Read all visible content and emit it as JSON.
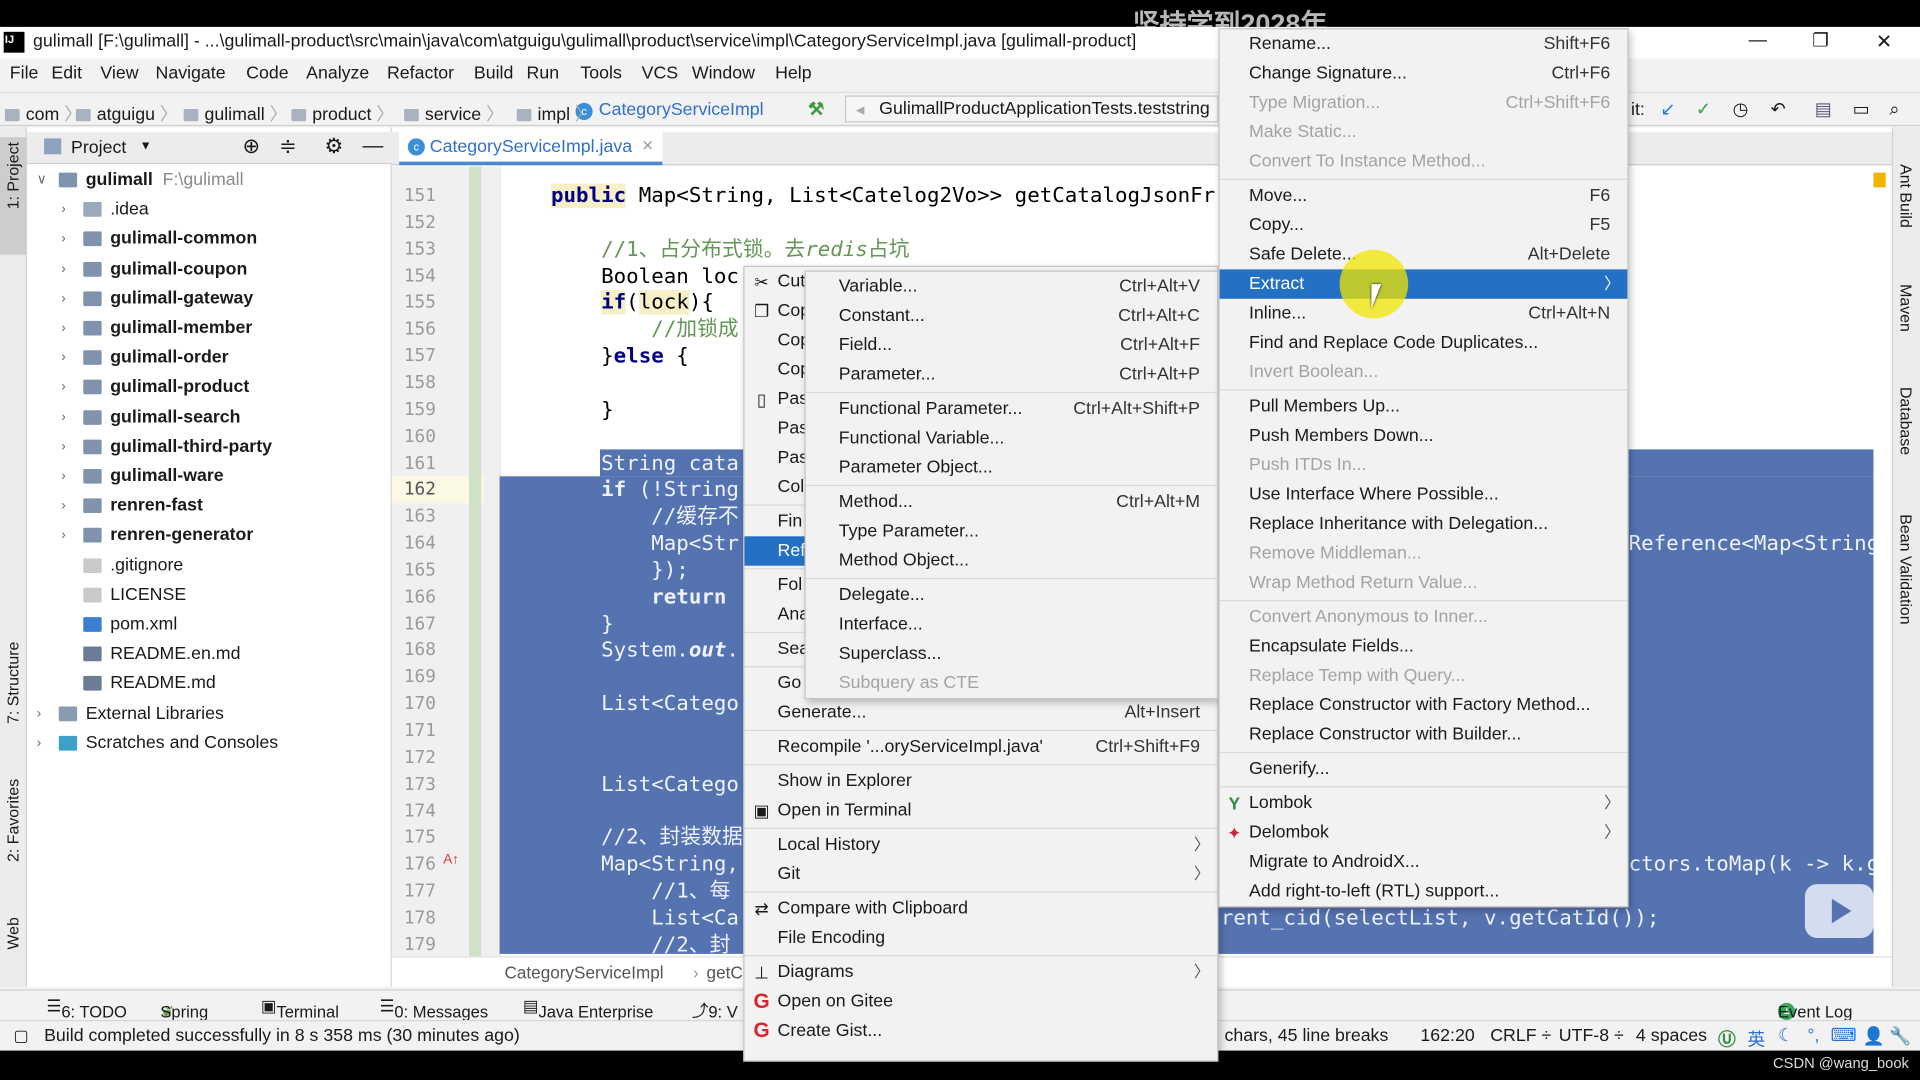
{
  "overlay": {
    "watermark": "坚持学到2028年",
    "credit": "CSDN @wang_book"
  },
  "titlebar": {
    "title": "gulimall [F:\\gulimall] - ...\\gulimall-product\\src\\main\\java\\com\\atguigu\\gulimall\\product\\service\\impl\\CategoryServiceImpl.java [gulimall-product]",
    "minimize": "—",
    "restore": "❐",
    "close": "✕"
  },
  "menubar": [
    "File",
    "Edit",
    "View",
    "Navigate",
    "Code",
    "Analyze",
    "Refactor",
    "Build",
    "Run",
    "Tools",
    "VCS",
    "Window",
    "Help"
  ],
  "navbar": {
    "crumbs": [
      "com",
      "atguigu",
      "gulimall",
      "product",
      "service",
      "impl"
    ],
    "current_class": "CategoryServiceImpl",
    "run_config": "GulimallProductApplicationTests.teststring",
    "git_label": "it:"
  },
  "left_strip": {
    "project": "1: Project",
    "structure": "7: Structure",
    "favorites": "2: Favorites",
    "web": "Web"
  },
  "right_strip": {
    "ant": "Ant Build",
    "maven": "Maven",
    "database": "Database",
    "bean": "Bean Validation"
  },
  "project": {
    "header": "Project",
    "tree": [
      {
        "label": "gulimall",
        "hint": "F:\\gulimall",
        "bold": true,
        "indent": 0,
        "arrow": "∨",
        "icon": "module-folder-icon"
      },
      {
        "label": ".idea",
        "bold": false,
        "indent": 1,
        "arrow": "›",
        "icon": "folder-icon"
      },
      {
        "label": "gulimall-common",
        "bold": true,
        "indent": 1,
        "arrow": "›",
        "icon": "module-folder-icon"
      },
      {
        "label": "gulimall-coupon",
        "bold": true,
        "indent": 1,
        "arrow": "›",
        "icon": "module-folder-icon"
      },
      {
        "label": "gulimall-gateway",
        "bold": true,
        "indent": 1,
        "arrow": "›",
        "icon": "module-folder-icon"
      },
      {
        "label": "gulimall-member",
        "bold": true,
        "indent": 1,
        "arrow": "›",
        "icon": "module-folder-icon"
      },
      {
        "label": "gulimall-order",
        "bold": true,
        "indent": 1,
        "arrow": "›",
        "icon": "module-folder-icon"
      },
      {
        "label": "gulimall-product",
        "bold": true,
        "indent": 1,
        "arrow": "›",
        "icon": "module-folder-icon"
      },
      {
        "label": "gulimall-search",
        "bold": true,
        "indent": 1,
        "arrow": "›",
        "icon": "module-folder-icon"
      },
      {
        "label": "gulimall-third-party",
        "bold": true,
        "indent": 1,
        "arrow": "›",
        "icon": "module-folder-icon"
      },
      {
        "label": "gulimall-ware",
        "bold": true,
        "indent": 1,
        "arrow": "›",
        "icon": "module-folder-icon"
      },
      {
        "label": "renren-fast",
        "bold": true,
        "indent": 1,
        "arrow": "›",
        "icon": "module-folder-icon"
      },
      {
        "label": "renren-generator",
        "bold": true,
        "indent": 1,
        "arrow": "›",
        "icon": "module-folder-icon"
      },
      {
        "label": ".gitignore",
        "bold": false,
        "indent": 1,
        "arrow": "",
        "icon": "file-icon"
      },
      {
        "label": "LICENSE",
        "bold": false,
        "indent": 1,
        "arrow": "",
        "icon": "file-icon"
      },
      {
        "label": "pom.xml",
        "bold": false,
        "indent": 1,
        "arrow": "",
        "icon": "maven-icon"
      },
      {
        "label": "README.en.md",
        "bold": false,
        "indent": 1,
        "arrow": "",
        "icon": "markdown-icon"
      },
      {
        "label": "README.md",
        "bold": false,
        "indent": 1,
        "arrow": "",
        "icon": "markdown-icon"
      },
      {
        "label": "External Libraries",
        "bold": false,
        "indent": 0,
        "arrow": "›",
        "icon": "library-icon"
      },
      {
        "label": "Scratches and Consoles",
        "bold": false,
        "indent": 0,
        "arrow": "›",
        "icon": "scratches-icon"
      }
    ]
  },
  "editor": {
    "tab": "CategoryServiceImpl.java",
    "current_line": 162,
    "lines": [
      {
        "num": "151",
        "seg": [
          [
            "    ",
            ""
          ],
          [
            "public",
            "kw kwbg"
          ],
          [
            " Map<String, List<Catelog2Vo>> getCatalogJsonFr",
            ""
          ]
        ]
      },
      {
        "num": "152",
        "seg": []
      },
      {
        "num": "153",
        "seg": [
          [
            "        //1、占分布式锁。去",
            "cm"
          ],
          [
            "redis",
            "cm it"
          ],
          [
            "占坑",
            "cm"
          ]
        ]
      },
      {
        "num": "154",
        "seg": [
          [
            "        Boolean loc",
            ""
          ]
        ]
      },
      {
        "num": "155",
        "seg": [
          [
            "        ",
            ""
          ],
          [
            "if",
            "kw kwbg"
          ],
          [
            "(",
            ""
          ],
          [
            "lock",
            "hl"
          ],
          [
            "){",
            ""
          ]
        ]
      },
      {
        "num": "156",
        "seg": [
          [
            "            //加锁成",
            "cm"
          ]
        ]
      },
      {
        "num": "157",
        "seg": [
          [
            "        }",
            ""
          ],
          [
            "else",
            "kw"
          ],
          [
            " {",
            ""
          ]
        ]
      },
      {
        "num": "158",
        "seg": []
      },
      {
        "num": "159",
        "seg": [
          [
            "        }",
            ""
          ]
        ]
      },
      {
        "num": "160",
        "seg": []
      },
      {
        "num": "161",
        "seg": [
          [
            "        String cata",
            ""
          ]
        ]
      },
      {
        "num": "162",
        "seg": [
          [
            "        ",
            ""
          ],
          [
            "if",
            "kw"
          ],
          [
            " (!String",
            ""
          ]
        ]
      },
      {
        "num": "163",
        "seg": [
          [
            "            //缓存不",
            "cm"
          ]
        ]
      },
      {
        "num": "164",
        "seg": [
          [
            "            Map<Str",
            ""
          ]
        ]
      },
      {
        "num": "165",
        "seg": [
          [
            "            });",
            ""
          ]
        ]
      },
      {
        "num": "166",
        "seg": [
          [
            "            ",
            ""
          ],
          [
            "return",
            "kw"
          ]
        ]
      },
      {
        "num": "167",
        "seg": [
          [
            "        }",
            ""
          ]
        ]
      },
      {
        "num": "168",
        "seg": [
          [
            "        System.",
            ""
          ],
          [
            "out",
            "kw it"
          ],
          [
            ".",
            ""
          ]
        ]
      },
      {
        "num": "169",
        "seg": []
      },
      {
        "num": "170",
        "seg": [
          [
            "        List<Catego",
            ""
          ]
        ]
      },
      {
        "num": "171",
        "seg": []
      },
      {
        "num": "172",
        "seg": []
      },
      {
        "num": "173",
        "seg": [
          [
            "        List<Catego",
            ""
          ]
        ]
      },
      {
        "num": "174",
        "seg": []
      },
      {
        "num": "175",
        "seg": [
          [
            "        //2、封装数据",
            "cm"
          ]
        ]
      },
      {
        "num": "176",
        "seg": [
          [
            "        Map<String,",
            ""
          ]
        ]
      },
      {
        "num": "177",
        "seg": [
          [
            "            //1、每",
            "cm"
          ]
        ]
      },
      {
        "num": "178",
        "seg": [
          [
            "            List<Ca",
            ""
          ]
        ]
      },
      {
        "num": "179",
        "seg": [
          [
            "            //2、封",
            "cm"
          ]
        ]
      }
    ],
    "fragments": {
      "line164_right": "Reference<Map<String,",
      "line176_right": "ctors.toMap(k -> k.ge",
      "line178_right": "rent_cid(selectList, v.getCatId());"
    },
    "breadcrumb": [
      "CategoryServiceImpl",
      "getC"
    ]
  },
  "context_menu": [
    {
      "label": "Cut",
      "icon": "scissors-icon",
      "glyph": "✂"
    },
    {
      "label": "Cop",
      "icon": "copy-icon",
      "glyph": "❐"
    },
    {
      "label": "Cop"
    },
    {
      "label": "Cop"
    },
    {
      "label": "Pas",
      "icon": "paste-icon",
      "glyph": "▯"
    },
    {
      "label": "Pas"
    },
    {
      "label": "Pas"
    },
    {
      "label": "Col"
    },
    {
      "label": "Fin",
      "sep": true
    },
    {
      "label": "Ref",
      "highlighted": true
    },
    {
      "label": "Fol",
      "sep": true
    },
    {
      "label": "Ana"
    },
    {
      "label": "Sea",
      "sep": true
    },
    {
      "label": "Go",
      "sep": true
    },
    {
      "label": "Generate...",
      "shortcut": "Alt+Insert"
    },
    {
      "label": "Recompile '...oryServiceImpl.java'",
      "shortcut": "Ctrl+Shift+F9",
      "sep": true
    },
    {
      "label": "Show in Explorer",
      "sep": true
    },
    {
      "label": "Open in Terminal",
      "icon": "terminal-icon",
      "glyph": "▣"
    },
    {
      "label": "Local History",
      "submenu": true,
      "sep": true
    },
    {
      "label": "Git",
      "submenu": true
    },
    {
      "label": "Compare with Clipboard",
      "icon": "compare-clipboard-icon",
      "glyph": "⇄",
      "sep": true
    },
    {
      "label": "File Encoding"
    },
    {
      "label": "Diagrams",
      "icon": "diagrams-icon",
      "glyph": "⊥",
      "submenu": true,
      "sep": true
    },
    {
      "label": "Open on Gitee",
      "icon": "gitee-icon",
      "glyph": "G"
    },
    {
      "label": "Create Gist...",
      "icon": "gitee-icon",
      "glyph": "G"
    }
  ],
  "extract_menu": [
    {
      "label": "Variable...",
      "shortcut": "Ctrl+Alt+V"
    },
    {
      "label": "Constant...",
      "shortcut": "Ctrl+Alt+C"
    },
    {
      "label": "Field...",
      "shortcut": "Ctrl+Alt+F"
    },
    {
      "label": "Parameter...",
      "shortcut": "Ctrl+Alt+P"
    },
    {
      "label": "Functional Parameter...",
      "shortcut": "Ctrl+Alt+Shift+P",
      "sep": true
    },
    {
      "label": "Functional Variable..."
    },
    {
      "label": "Parameter Object..."
    },
    {
      "label": "Method...",
      "shortcut": "Ctrl+Alt+M",
      "sep": true
    },
    {
      "label": "Type Parameter..."
    },
    {
      "label": "Method Object..."
    },
    {
      "label": "Delegate...",
      "sep": true
    },
    {
      "label": "Interface..."
    },
    {
      "label": "Superclass..."
    },
    {
      "label": "Subquery as CTE",
      "disabled": true
    }
  ],
  "refactor_menu": [
    {
      "label": "Rename...",
      "shortcut": "Shift+F6"
    },
    {
      "label": "Change Signature...",
      "shortcut": "Ctrl+F6"
    },
    {
      "label": "Type Migration...",
      "shortcut": "Ctrl+Shift+F6",
      "disabled": true
    },
    {
      "label": "Make Static...",
      "disabled": true
    },
    {
      "label": "Convert To Instance Method...",
      "disabled": true
    },
    {
      "label": "Move...",
      "shortcut": "F6",
      "sep": true
    },
    {
      "label": "Copy...",
      "shortcut": "F5"
    },
    {
      "label": "Safe Delete...",
      "shortcut": "Alt+Delete"
    },
    {
      "label": "Extract",
      "submenu": true,
      "highlighted": true
    },
    {
      "label": "Inline...",
      "shortcut": "Ctrl+Alt+N"
    },
    {
      "label": "Find and Replace Code Duplicates..."
    },
    {
      "label": "Invert Boolean...",
      "disabled": true
    },
    {
      "label": "Pull Members Up...",
      "sep": true
    },
    {
      "label": "Push Members Down..."
    },
    {
      "label": "Push ITDs In...",
      "disabled": true
    },
    {
      "label": "Use Interface Where Possible..."
    },
    {
      "label": "Replace Inheritance with Delegation..."
    },
    {
      "label": "Remove Middleman...",
      "disabled": true
    },
    {
      "label": "Wrap Method Return Value...",
      "disabled": true
    },
    {
      "label": "Convert Anonymous to Inner...",
      "disabled": true,
      "sep": true
    },
    {
      "label": "Encapsulate Fields..."
    },
    {
      "label": "Replace Temp with Query...",
      "disabled": true
    },
    {
      "label": "Replace Constructor with Factory Method..."
    },
    {
      "label": "Replace Constructor with Builder..."
    },
    {
      "label": "Generify...",
      "sep": true
    },
    {
      "label": "Lombok",
      "icon": "lombok-icon",
      "glyph": "Y",
      "submenu": true,
      "sep": true
    },
    {
      "label": "Delombok",
      "icon": "delombok-icon",
      "glyph": "✦",
      "submenu": true
    },
    {
      "label": "Migrate to AndroidX..."
    },
    {
      "label": "Add right-to-left (RTL) support..."
    }
  ],
  "bottom_tools": {
    "todo": "6: TODO",
    "spring": "Spring",
    "terminal": "Terminal",
    "messages": "0: Messages",
    "java_ee": "Java Enterprise",
    "vcs": "9: V",
    "event_log": "Event Log",
    "event_count": "1"
  },
  "status": {
    "message": "Build completed successfully in 8 s 358 ms (30 minutes ago)",
    "selection": "chars, 45 line breaks",
    "position": "162:20",
    "line_sep": "CRLF ÷",
    "encoding": "UTF-8 ÷",
    "indent": "4 spaces",
    "ime": "英"
  },
  "colors": {
    "highlight": "#2470c4",
    "selection": "#5573b0",
    "accent": "#4a88d0",
    "gitee": "#d8262c"
  }
}
